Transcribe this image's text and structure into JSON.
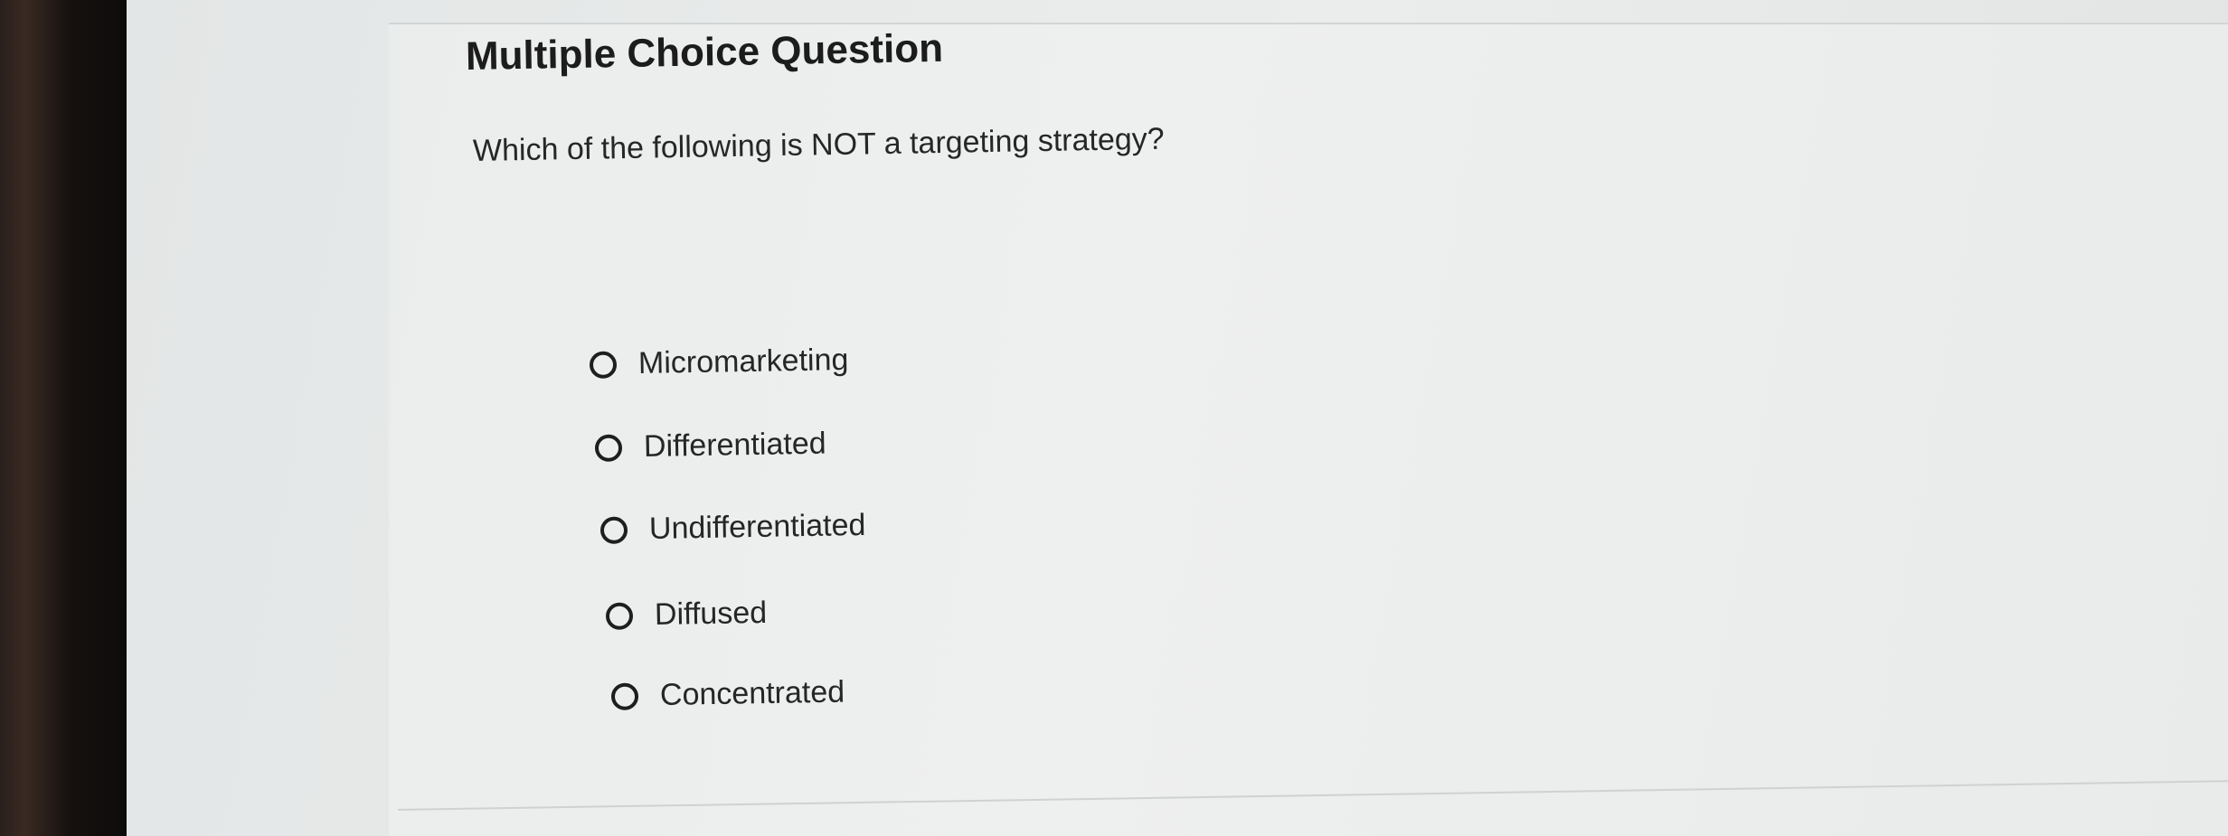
{
  "question": {
    "type_label": "Multiple Choice Question",
    "prompt": "Which of the following is NOT a targeting strategy?",
    "options": [
      {
        "label": "Micromarketing",
        "selected": false
      },
      {
        "label": "Differentiated",
        "selected": false
      },
      {
        "label": "Undifferentiated",
        "selected": false
      },
      {
        "label": "Diffused",
        "selected": false
      },
      {
        "label": "Concentrated",
        "selected": false
      }
    ]
  },
  "colors": {
    "text": "#262626",
    "background": "#ebeded"
  }
}
